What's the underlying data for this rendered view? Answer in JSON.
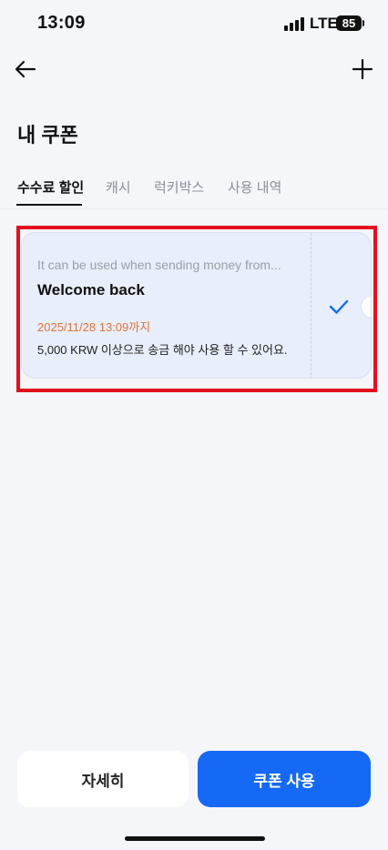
{
  "status_bar": {
    "time": "13:09",
    "network": "LTE",
    "battery": "85"
  },
  "header": {
    "back_icon": "arrow-left-icon",
    "add_icon": "plus-icon",
    "title": "내 쿠폰"
  },
  "tabs": [
    {
      "label": "수수료 할인",
      "active": true
    },
    {
      "label": "캐시",
      "active": false
    },
    {
      "label": "럭키박스",
      "active": false
    },
    {
      "label": "사용 내역",
      "active": false
    }
  ],
  "coupon": {
    "description": "It can be used when sending money from...",
    "title": "Welcome back",
    "expiry": "2025/11/28 13:09까지",
    "condition": "5,000 KRW 이상으로 송금 해야 사용 할 수 있어요.",
    "selected": true,
    "check_icon": "checkmark-icon"
  },
  "buttons": {
    "detail": "자세히",
    "use": "쿠폰 사용"
  },
  "colors": {
    "accent": "#1569f5",
    "expiry_text": "#e0743a",
    "highlight_border": "#e3101e",
    "coupon_bg": "#e8eefb"
  }
}
